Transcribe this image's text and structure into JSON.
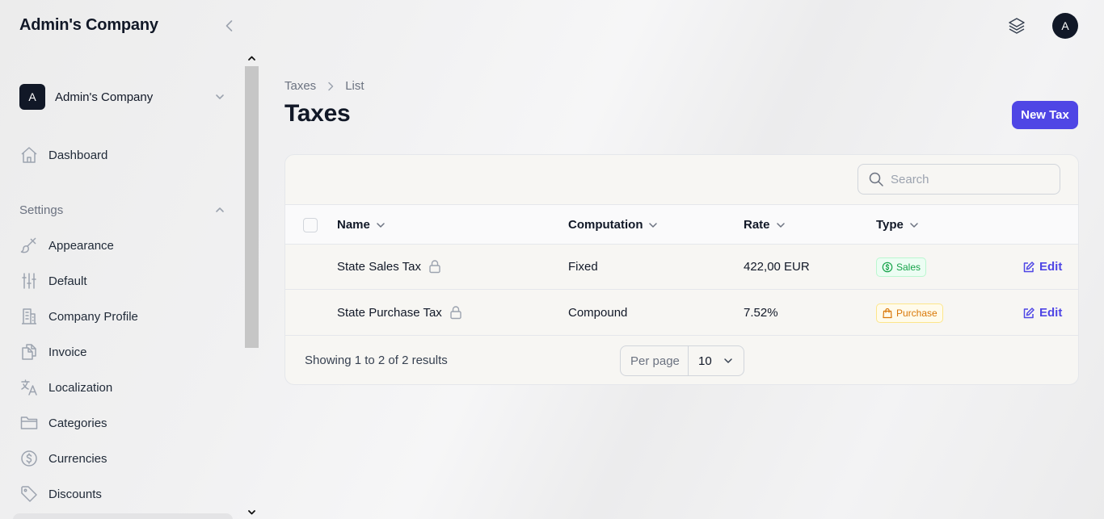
{
  "sidebar": {
    "brand": "Admin's Company",
    "company": {
      "initial": "A",
      "name": "Admin's Company"
    },
    "dashboard": "Dashboard",
    "settings_group": "Settings",
    "items": [
      {
        "label": "Appearance",
        "icon": "paintbrush-icon"
      },
      {
        "label": "Default",
        "icon": "sliders-icon"
      },
      {
        "label": "Company Profile",
        "icon": "building-icon"
      },
      {
        "label": "Invoice",
        "icon": "document-duplicate-icon"
      },
      {
        "label": "Localization",
        "icon": "language-icon"
      },
      {
        "label": "Categories",
        "icon": "folder-icon"
      },
      {
        "label": "Currencies",
        "icon": "currency-dollar-icon"
      },
      {
        "label": "Discounts",
        "icon": "tag-icon"
      }
    ]
  },
  "topbar": {
    "user_initial": "A"
  },
  "breadcrumb": {
    "parent": "Taxes",
    "current": "List"
  },
  "page": {
    "title": "Taxes",
    "new_button": "New Tax"
  },
  "search": {
    "placeholder": "Search"
  },
  "table": {
    "columns": [
      "Name",
      "Computation",
      "Rate",
      "Type"
    ],
    "rows": [
      {
        "name": "State Sales Tax",
        "computation": "Fixed",
        "rate": "422,00 EUR",
        "type": "Sales",
        "action": "Edit"
      },
      {
        "name": "State Purchase Tax",
        "computation": "Compound",
        "rate": "7.52%",
        "type": "Purchase",
        "action": "Edit"
      }
    ]
  },
  "footer": {
    "summary": "Showing 1 to 2 of 2 results",
    "per_page_label": "Per page",
    "per_page_value": "10"
  },
  "colors": {
    "primary": "#4f46e5",
    "sales_badge": "#16a34a",
    "purchase_badge": "#d97706",
    "avatar_bg": "#111827"
  }
}
